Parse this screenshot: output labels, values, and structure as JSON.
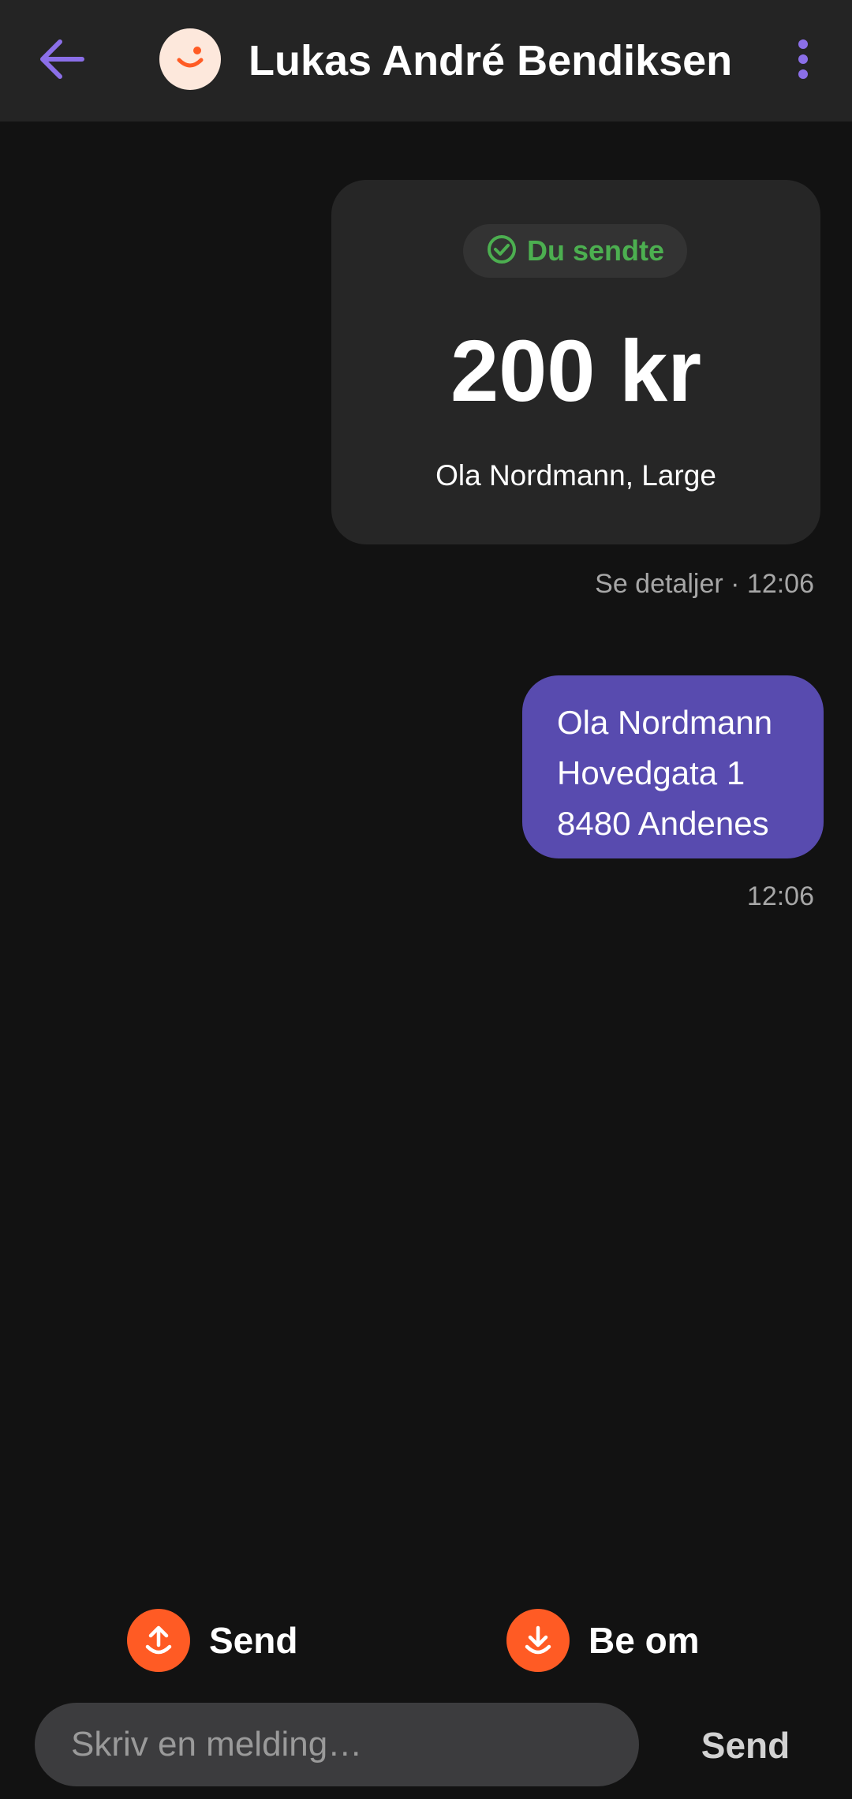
{
  "header": {
    "contact_name": "Lukas André Bendiksen",
    "back_icon": "arrow-left-icon",
    "menu_icon": "more-vertical-icon",
    "avatar_icon": "smile-avatar-icon"
  },
  "payment": {
    "status": "Du sendte",
    "status_icon": "check-circle-icon",
    "amount": "200 kr",
    "description": "Ola Nordmann, Large",
    "details_link": "Se detaljer",
    "separator": " · ",
    "time": "12:06"
  },
  "message": {
    "lines": [
      "Ola Nordmann",
      "Hovedgata 1",
      "8480 Andenes"
    ],
    "time": "12:06"
  },
  "actions": {
    "send_label": "Send",
    "send_icon": "upload-arrow-icon",
    "request_label": "Be om",
    "request_icon": "download-arrow-icon"
  },
  "composer": {
    "placeholder": "Skriv en melding…",
    "value": "",
    "send_label": "Send"
  },
  "colors": {
    "accent_purple": "#8b6fe8",
    "bubble": "#584baf",
    "vipps_orange": "#ff5b24",
    "success_green": "#4caf50"
  }
}
